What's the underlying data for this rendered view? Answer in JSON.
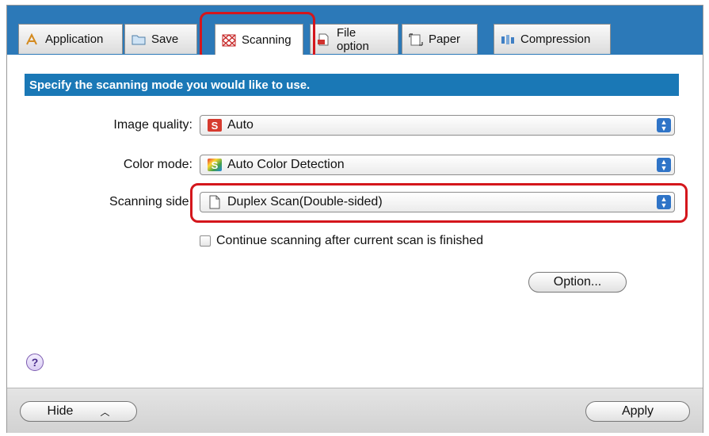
{
  "tabs": [
    {
      "label": "Application",
      "icon": "application-icon",
      "active": false
    },
    {
      "label": "Save",
      "icon": "folder-icon",
      "active": false
    },
    {
      "label": "Scanning",
      "icon": "scanning-icon",
      "active": true
    },
    {
      "label": "File option",
      "icon": "file-option-icon",
      "active": false
    },
    {
      "label": "Paper",
      "icon": "paper-icon",
      "active": false
    },
    {
      "label": "Compression",
      "icon": "compression-icon",
      "active": false
    }
  ],
  "main": {
    "banner": "Specify the scanning mode you would like to use.",
    "image_quality": {
      "label": "Image quality:",
      "value": "Auto"
    },
    "color_mode": {
      "label": "Color mode:",
      "value": "Auto Color Detection"
    },
    "scanning_side": {
      "label": "Scanning side:",
      "value": "Duplex Scan(Double-sided)"
    },
    "continue_checkbox": {
      "label": "Continue scanning after current scan is finished",
      "checked": false
    },
    "option_button": "Option...",
    "help_glyph": "?"
  },
  "footer": {
    "hide_button": "Hide",
    "apply_button": "Apply"
  },
  "colors": {
    "tabstrip": "#2c79b8",
    "banner": "#1a78b6",
    "highlight": "#d4161c",
    "popup_arrow": "#2f74c7"
  }
}
